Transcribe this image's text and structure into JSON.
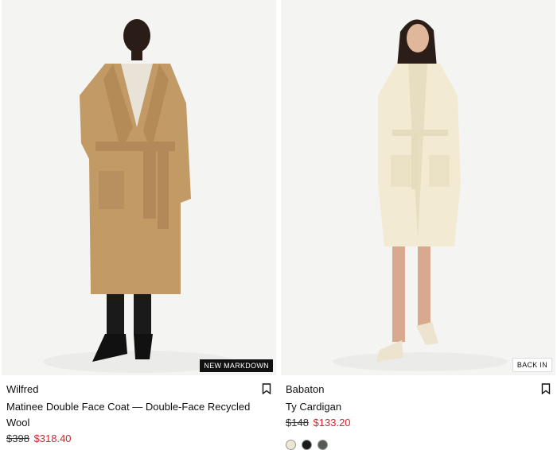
{
  "products": [
    {
      "brand": "Wilfred",
      "name": "Matinee Double Face Coat — Double-Face Recycled Wool",
      "old_price": "$398",
      "new_price": "$318.40",
      "badge": "NEW MARKDOWN",
      "image_alt": "coat-photo",
      "coat_color": "#c29a66"
    },
    {
      "brand": "Babaton",
      "name": "Ty Cardigan",
      "old_price": "$148",
      "new_price": "$133.20",
      "badge": "BACK IN",
      "image_alt": "cardigan-photo",
      "swatches": [
        "#ece6d4",
        "#1b1b1b",
        "#555a55"
      ]
    }
  ],
  "colors": {
    "sale_price": "#d8232a",
    "badge_dark": "#111111"
  }
}
